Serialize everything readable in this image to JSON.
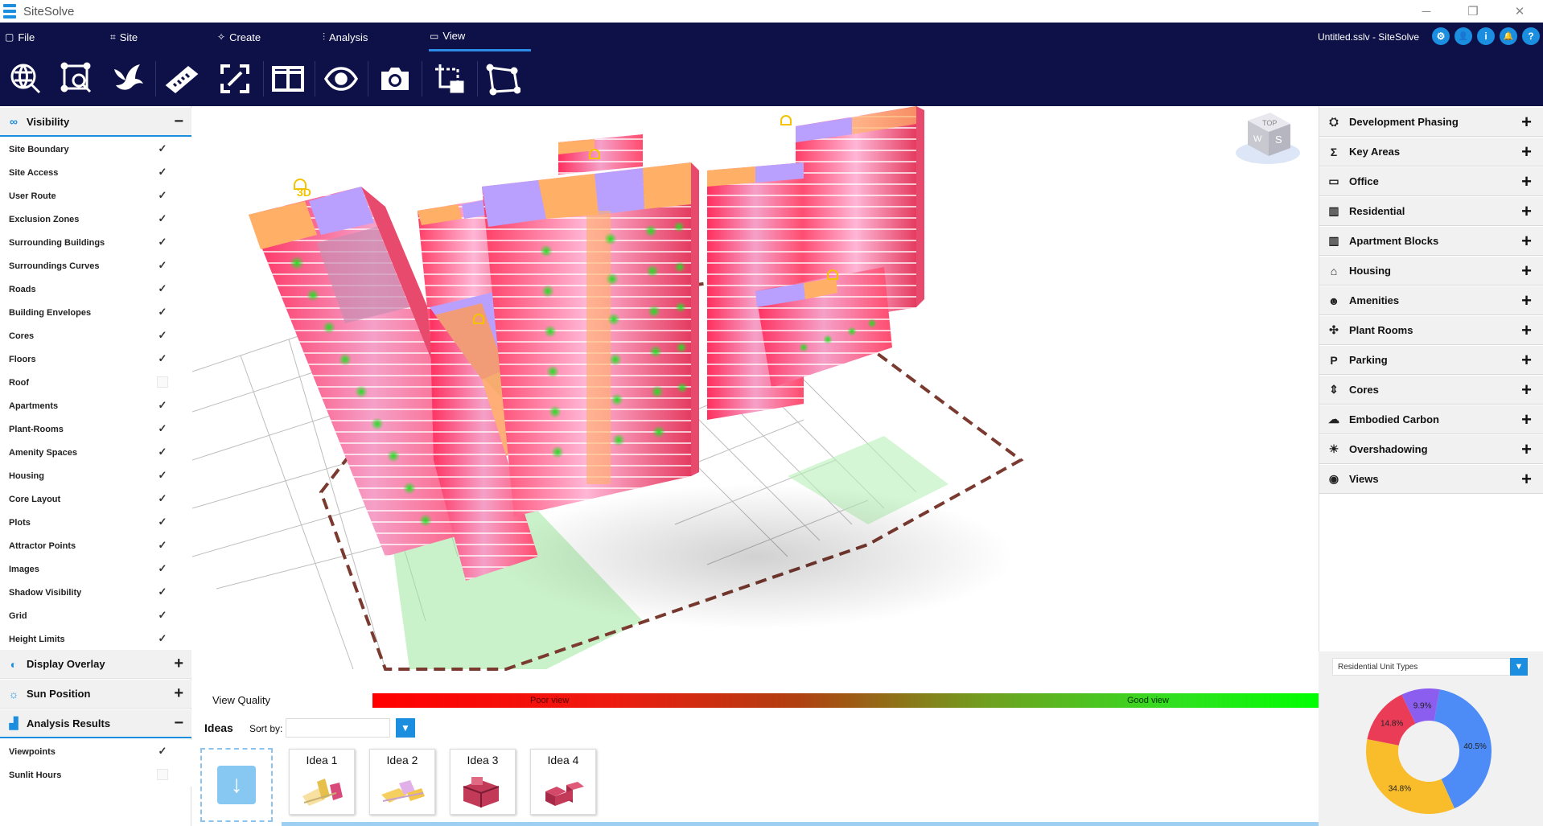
{
  "app": {
    "name": "SiteSolve",
    "document_title": "Untitled.sslv - SiteSolve"
  },
  "window_controls": {
    "minimize": "─",
    "restore": "❐",
    "close": "✕"
  },
  "menu": [
    {
      "label": "File",
      "icon": "file-icon"
    },
    {
      "label": "Site",
      "icon": "site-icon"
    },
    {
      "label": "Create",
      "icon": "create-icon"
    },
    {
      "label": "Analysis",
      "icon": "analysis-icon"
    },
    {
      "label": "View",
      "icon": "view-icon",
      "active": true
    }
  ],
  "header_icons": [
    {
      "name": "settings-icon",
      "glyph": "⚙"
    },
    {
      "name": "user-icon",
      "glyph": "👤"
    },
    {
      "name": "info-icon",
      "glyph": "i"
    },
    {
      "name": "bell-icon",
      "glyph": "🔔"
    },
    {
      "name": "help-icon",
      "glyph": "?"
    }
  ],
  "toolbar": [
    "globe-search-icon",
    "boundary-search-icon",
    "bird-icon",
    "ruler-icon",
    "fullscreen-icon",
    "split-view-icon",
    "eye-icon",
    "camera-icon",
    "crop-icon",
    "polygon-icon"
  ],
  "left": {
    "visibility": {
      "title": "Visibility",
      "toggle": "−",
      "items": [
        {
          "label": "Site Boundary",
          "checked": true
        },
        {
          "label": "Site Access",
          "checked": true
        },
        {
          "label": "User Route",
          "checked": true
        },
        {
          "label": "Exclusion Zones",
          "checked": true
        },
        {
          "label": "Surrounding Buildings",
          "checked": true
        },
        {
          "label": "Surroundings Curves",
          "checked": true
        },
        {
          "label": "Roads",
          "checked": true
        },
        {
          "label": "Building Envelopes",
          "checked": true
        },
        {
          "label": "Cores",
          "checked": true
        },
        {
          "label": "Floors",
          "checked": true
        },
        {
          "label": "Roof",
          "checked": false
        },
        {
          "label": "Apartments",
          "checked": true
        },
        {
          "label": "Plant-Rooms",
          "checked": true
        },
        {
          "label": "Amenity Spaces",
          "checked": true
        },
        {
          "label": "Housing",
          "checked": true
        },
        {
          "label": "Core Layout",
          "checked": true
        },
        {
          "label": "Plots",
          "checked": true
        },
        {
          "label": "Attractor Points",
          "checked": true
        },
        {
          "label": "Images",
          "checked": true
        },
        {
          "label": "Shadow Visibility",
          "checked": true
        },
        {
          "label": "Grid",
          "checked": true
        },
        {
          "label": "Height Limits",
          "checked": true
        }
      ]
    },
    "display_overlay": {
      "title": "Display Overlay",
      "toggle": "+"
    },
    "sun_position": {
      "title": "Sun Position",
      "toggle": "+"
    },
    "analysis_results": {
      "title": "Analysis Results",
      "toggle": "−",
      "items": [
        {
          "label": "Viewpoints",
          "checked": true
        },
        {
          "label": "Sunlit Hours",
          "checked": false
        }
      ]
    }
  },
  "check_glyph": "✓",
  "view_quality": {
    "label": "View Quality",
    "poor": "Poor view",
    "good": "Good view"
  },
  "viewport": {
    "lock_badge": "3D",
    "navcube_top": "TOP",
    "navcube_w": "W",
    "navcube_s": "S"
  },
  "ideas": {
    "title": "Ideas",
    "sort_label": "Sort by:",
    "sort_value": "",
    "download_glyph": "↓",
    "items": [
      {
        "label": "Idea 1"
      },
      {
        "label": "Idea 2"
      },
      {
        "label": "Idea 3"
      },
      {
        "label": "Idea 4"
      }
    ]
  },
  "right": {
    "sections": [
      {
        "label": "Development Phasing",
        "icon": "phasing-icon",
        "glyph": "⛭"
      },
      {
        "label": "Key Areas",
        "icon": "sigma-icon",
        "glyph": "Σ"
      },
      {
        "label": "Office",
        "icon": "monitor-icon",
        "glyph": "▭"
      },
      {
        "label": "Residential",
        "icon": "building-icon",
        "glyph": "▥"
      },
      {
        "label": "Apartment Blocks",
        "icon": "apartment-icon",
        "glyph": "▥"
      },
      {
        "label": "Housing",
        "icon": "house-icon",
        "glyph": "⌂"
      },
      {
        "label": "Amenities",
        "icon": "people-icon",
        "glyph": "☻"
      },
      {
        "label": "Plant Rooms",
        "icon": "fan-icon",
        "glyph": "✣"
      },
      {
        "label": "Parking",
        "icon": "parking-icon",
        "glyph": "P"
      },
      {
        "label": "Cores",
        "icon": "elevator-icon",
        "glyph": "⇕"
      },
      {
        "label": "Embodied Carbon",
        "icon": "cloud-icon",
        "glyph": "☁"
      },
      {
        "label": "Overshadowing",
        "icon": "sun-icon",
        "glyph": "☀"
      },
      {
        "label": "Views",
        "icon": "eye-icon",
        "glyph": "◉"
      }
    ],
    "plus": "+"
  },
  "unit_types": {
    "select_value": "Residential Unit Types",
    "colors": {
      "blue": "#4d8cf7",
      "yellow": "#f9bd2c",
      "red": "#ea3c57",
      "purple": "#8c5ef0"
    }
  },
  "chart_data": {
    "type": "pie",
    "title": "",
    "slices": [
      {
        "label": "40.5%",
        "value": 40.5,
        "color": "#4d8cf7"
      },
      {
        "label": "34.8%",
        "value": 34.8,
        "color": "#f9bd2c"
      },
      {
        "label": "14.8%",
        "value": 14.8,
        "color": "#ea3c57"
      },
      {
        "label": "9.9%",
        "value": 9.9,
        "color": "#8c5ef0"
      }
    ]
  }
}
